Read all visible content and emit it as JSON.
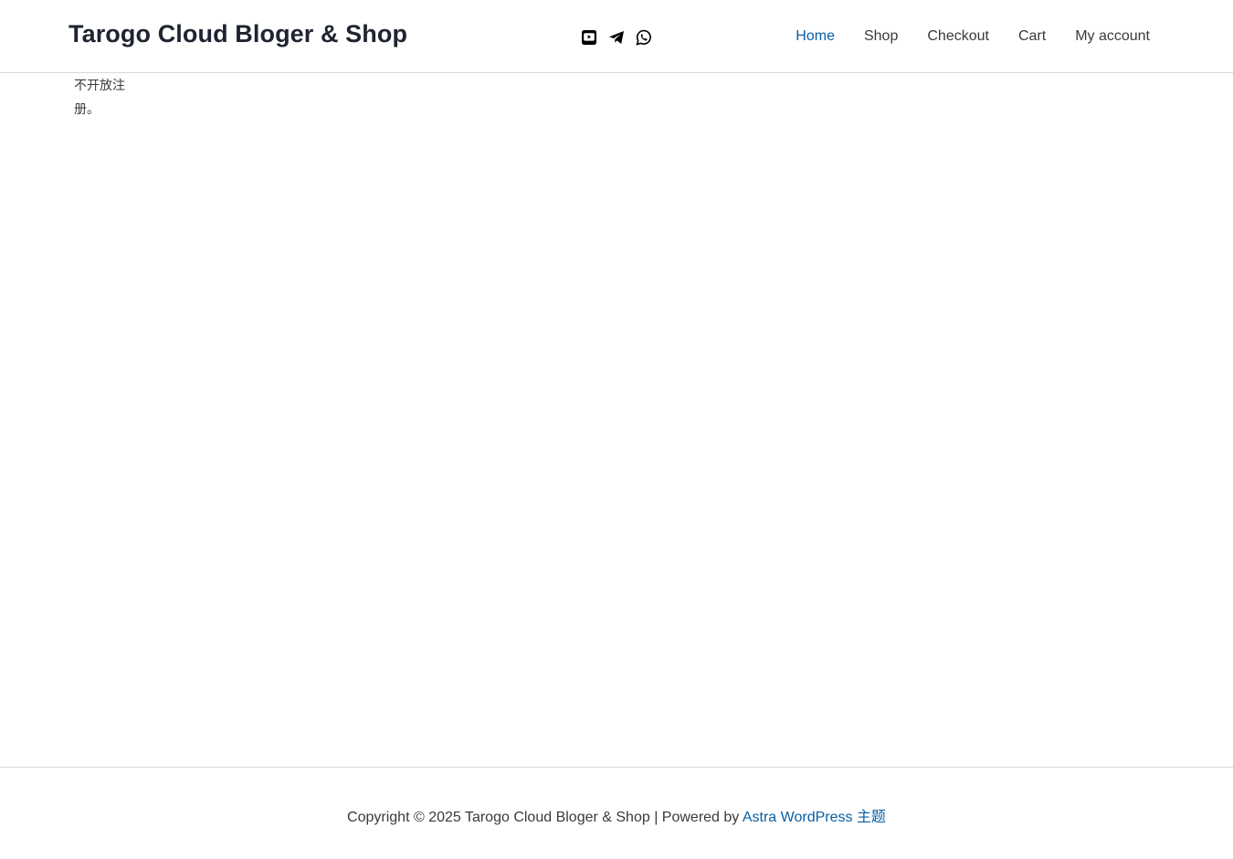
{
  "header": {
    "site_title": "Tarogo Cloud Bloger & Shop",
    "social": [
      {
        "icon": "youtube-icon"
      },
      {
        "icon": "telegram-icon"
      },
      {
        "icon": "whatsapp-icon"
      }
    ],
    "nav": [
      {
        "label": "Home",
        "active": true
      },
      {
        "label": "Shop"
      },
      {
        "label": "Checkout"
      },
      {
        "label": "Cart"
      },
      {
        "label": "My account"
      }
    ]
  },
  "main": {
    "message": "不开放注册。"
  },
  "footer": {
    "copyright_prefix": "Copyright © 2025 Tarogo Cloud Bloger & Shop | Powered by ",
    "theme_link": "Astra WordPress 主题"
  },
  "colors": {
    "accent": "#0a5fa5",
    "text": "#3a3a3a",
    "title": "#1e2430",
    "border": "#d9d9d9"
  }
}
